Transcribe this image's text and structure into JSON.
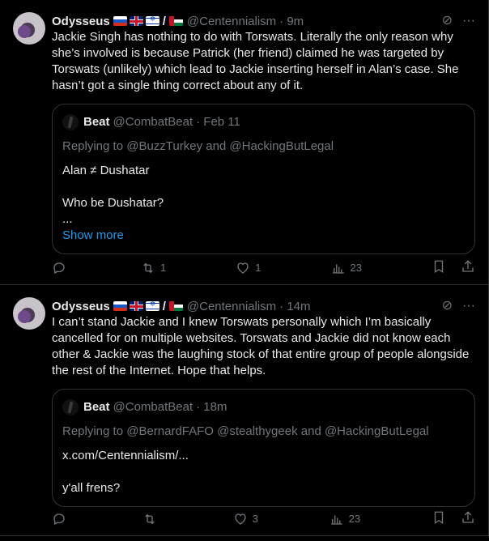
{
  "tweets": [
    {
      "author": {
        "name": "Odysseus",
        "handle": "@Centennialism",
        "time": "· 9m"
      },
      "text": "Jackie Singh has nothing to do with Torswats. Literally the only reason why she’s involved is because Patrick (her friend) claimed he was targeted by Torswats (unlikely) which lead to Jackie inserting herself in Alan’s case. She hasn’t got a single thing correct about any of it.",
      "quote": {
        "name": "Beat",
        "handle": "@CombatBeat",
        "time": "· Feb 11",
        "replying": "Replying to @BuzzTurkey and @HackingButLegal",
        "line1": "Alan ≠ Dushatar",
        "line2": "Who be Dushatar?",
        "line3": "...",
        "show_more": "Show more"
      },
      "stats": {
        "replies": "",
        "retweets": "1",
        "likes": "1",
        "views": "23"
      }
    },
    {
      "author": {
        "name": "Odysseus",
        "handle": "@Centennialism",
        "time": "· 14m"
      },
      "text": "I can’t stand Jackie and I knew Torswats personally which I’m basically cancelled for on multiple websites. Torswats and Jackie did not know each other & Jackie was the laughing stock of that entire group of people alongside the rest of the Internet. Hope that helps.",
      "quote": {
        "name": "Beat",
        "handle": "@CombatBeat",
        "time": "· 18m",
        "replying": "Replying to @BernardFAFO @stealthygeek and @HackingButLegal",
        "line1": "x.com/Centennialism/...",
        "line2": "y'all frens?"
      },
      "stats": {
        "replies": "",
        "retweets": "",
        "likes": "3",
        "views": "23"
      }
    }
  ]
}
